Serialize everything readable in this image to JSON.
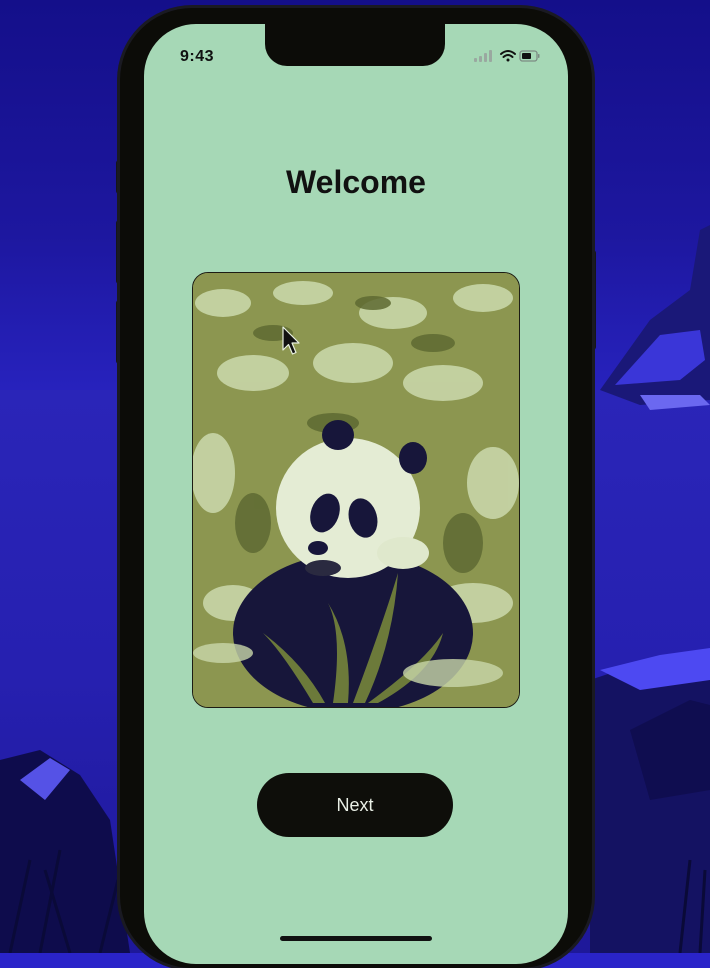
{
  "status_bar": {
    "time": "9:43"
  },
  "welcome": {
    "title": "Welcome",
    "next_label": "Next"
  },
  "colors": {
    "screen_background": "#a6d8b6",
    "button_background": "#0e0e0a",
    "desktop_background": "#2a24c9"
  },
  "icons": [
    "signal-icon",
    "wifi-icon",
    "battery-icon",
    "pointer-cursor-icon"
  ]
}
